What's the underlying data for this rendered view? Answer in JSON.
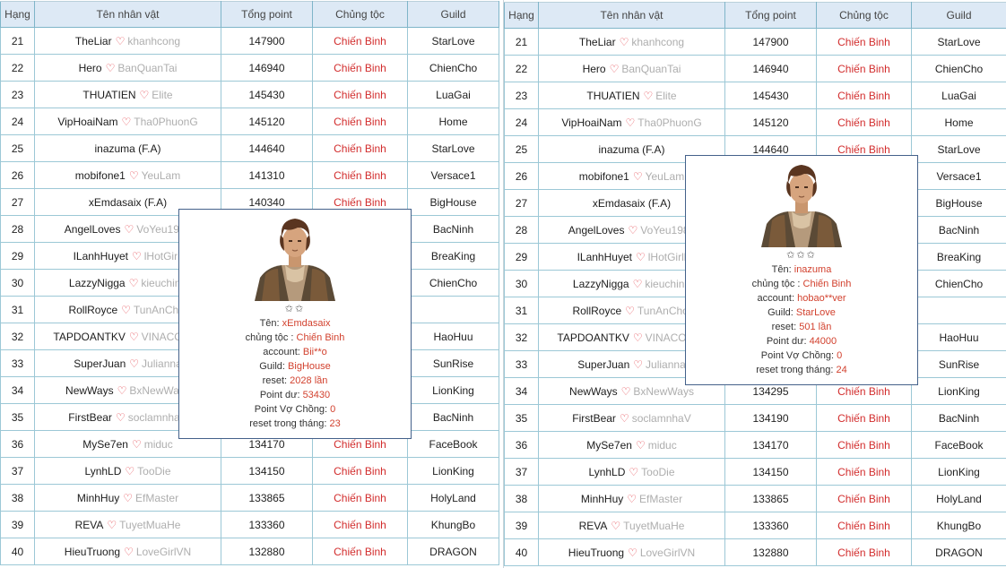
{
  "headers": {
    "rank": "Hạng",
    "name": "Tên nhân vật",
    "points": "Tổng point",
    "class": "Chủng tộc",
    "guild": "Guild"
  },
  "icons": {
    "heart": "heart-icon",
    "star": "star-outline-icon"
  },
  "colors": {
    "class_text": "#d22d2d",
    "spouse_text": "#aeaeae",
    "heart": "#e23a43",
    "header_bg": "#dde9f5"
  },
  "left": {
    "rows": [
      {
        "rank": "21",
        "name": "TheLiar",
        "spouse": "khanhcong",
        "points": "147900",
        "class": "Chiến Binh",
        "guild": "StarLove"
      },
      {
        "rank": "22",
        "name": "Hero",
        "spouse": "BanQuanTai",
        "points": "146940",
        "class": "Chiến Binh",
        "guild": "ChienCho"
      },
      {
        "rank": "23",
        "name": "THUATIEN",
        "spouse": "Elite",
        "points": "145430",
        "class": "Chiến Binh",
        "guild": "LuaGai"
      },
      {
        "rank": "24",
        "name": "VipHoaiNam",
        "spouse": "Tha0PhuonG",
        "points": "145120",
        "class": "Chiến Binh",
        "guild": "Home"
      },
      {
        "rank": "25",
        "name": "inazuma (F.A)",
        "spouse": "",
        "points": "144640",
        "class": "Chiến Binh",
        "guild": "StarLove"
      },
      {
        "rank": "26",
        "name": "mobifone1",
        "spouse": "YeuLam",
        "points": "141310",
        "class": "Chiến Binh",
        "guild": "Versace1"
      },
      {
        "rank": "27",
        "name": "xEmdasaix (F.A)",
        "spouse": "",
        "points": "140340",
        "class": "Chiến Binh",
        "guild": "BigHouse"
      },
      {
        "rank": "28",
        "name": "AngelLoves",
        "spouse": "VoYeu1988",
        "points": "1402",
        "class": "Chiến Binh",
        "guild": "BacNinh"
      },
      {
        "rank": "29",
        "name": "ILanhHuyet",
        "spouse": "lHotGirll",
        "points": "1388",
        "class": "Chiến Binh",
        "guild": "BreaKing"
      },
      {
        "rank": "30",
        "name": "LazzyNigga",
        "spouse": "kieuchinh",
        "points": "",
        "class": "Chiến Binh",
        "guild": "ChienCho"
      },
      {
        "rank": "31",
        "name": "RollRoyce",
        "spouse": "TunAnChoi",
        "points": "1353",
        "class": "Chiến Binh",
        "guild": ""
      },
      {
        "rank": "32",
        "name": "TAPDOANTKV",
        "spouse": "VINACOMIN",
        "points": "",
        "class": "Chiến Binh",
        "guild": "HaoHuu"
      },
      {
        "rank": "33",
        "name": "SuperJuan",
        "spouse": "Julianna",
        "points": "",
        "class": "Chiến Binh",
        "guild": "SunRise"
      },
      {
        "rank": "34",
        "name": "NewWays",
        "spouse": "BxNewWays",
        "points": "",
        "class": "Chiến Binh",
        "guild": "LionKing"
      },
      {
        "rank": "35",
        "name": "FirstBear",
        "spouse": "soclamnhaV",
        "points": "",
        "class": "Chiến Binh",
        "guild": "BacNinh"
      },
      {
        "rank": "36",
        "name": "MySe7en",
        "spouse": "miduc",
        "points": "134170",
        "class": "Chiến Binh",
        "guild": "FaceBook"
      },
      {
        "rank": "37",
        "name": "LynhLD",
        "spouse": "TooDie",
        "points": "134150",
        "class": "Chiến Binh",
        "guild": "LionKing"
      },
      {
        "rank": "38",
        "name": "MinhHuy",
        "spouse": "EfMaster",
        "points": "133865",
        "class": "Chiến Binh",
        "guild": "HolyLand"
      },
      {
        "rank": "39",
        "name": "REVA",
        "spouse": "TuyetMuaHe",
        "points": "133360",
        "class": "Chiến Binh",
        "guild": "KhungBo"
      },
      {
        "rank": "40",
        "name": "HieuTruong",
        "spouse": "LoveGirlVN",
        "points": "132880",
        "class": "Chiến Binh",
        "guild": "DRAGON"
      }
    ],
    "popup": {
      "stars": "✩✩",
      "name_label": "Tên:",
      "name_value": "xEmdasaix",
      "class_label": "chủng tộc :",
      "class_value": "Chiến Binh",
      "account_label": "account:",
      "account_value": "Bii**o",
      "guild_label": "Guild:",
      "guild_value": "BigHouse",
      "reset_label": "reset:",
      "reset_value": "2028 lần",
      "pointdu_label": "Point dư:",
      "pointdu_value": "53430",
      "spousepoint_label": "Point Vợ Chồng:",
      "spousepoint_value": "0",
      "monthreset_label": "reset trong tháng:",
      "monthreset_value": "23"
    }
  },
  "right": {
    "rows": [
      {
        "rank": "21",
        "name": "TheLiar",
        "spouse": "khanhcong",
        "points": "147900",
        "class": "Chiến Binh",
        "guild": "StarLove"
      },
      {
        "rank": "22",
        "name": "Hero",
        "spouse": "BanQuanTai",
        "points": "146940",
        "class": "Chiến Binh",
        "guild": "ChienCho"
      },
      {
        "rank": "23",
        "name": "THUATIEN",
        "spouse": "Elite",
        "points": "145430",
        "class": "Chiến Binh",
        "guild": "LuaGai"
      },
      {
        "rank": "24",
        "name": "VipHoaiNam",
        "spouse": "Tha0PhuonG",
        "points": "145120",
        "class": "Chiến Binh",
        "guild": "Home"
      },
      {
        "rank": "25",
        "name": "inazuma (F.A)",
        "spouse": "",
        "points": "144640",
        "class": "Chiến Binh",
        "guild": "StarLove"
      },
      {
        "rank": "26",
        "name": "mobifone1",
        "spouse": "YeuLam",
        "points": "14131",
        "class": "Chiến Binh",
        "guild": "Versace1"
      },
      {
        "rank": "27",
        "name": "xEmdasaix (F.A)",
        "spouse": "",
        "points": "14034",
        "class": "Chiến Binh",
        "guild": "BigHouse"
      },
      {
        "rank": "28",
        "name": "AngelLoves",
        "spouse": "VoYeu1988",
        "points": "",
        "class": "Chiến Binh",
        "guild": "BacNinh"
      },
      {
        "rank": "29",
        "name": "ILanhHuyet",
        "spouse": "lHotGirll",
        "points": "1388",
        "class": "Chiến Binh",
        "guild": "BreaKing"
      },
      {
        "rank": "30",
        "name": "LazzyNigga",
        "spouse": "kieuchinh",
        "points": "",
        "class": "Chiến Binh",
        "guild": "ChienCho"
      },
      {
        "rank": "31",
        "name": "RollRoyce",
        "spouse": "TunAnChoi",
        "points": "",
        "class": "Chiến Binh",
        "guild": ""
      },
      {
        "rank": "32",
        "name": "TAPDOANTKV",
        "spouse": "VINACOMIN",
        "points": "",
        "class": "Chiến Binh",
        "guild": "HaoHuu"
      },
      {
        "rank": "33",
        "name": "SuperJuan",
        "spouse": "Julianna",
        "points": "",
        "class": "Chiến Binh",
        "guild": "SunRise"
      },
      {
        "rank": "34",
        "name": "NewWays",
        "spouse": "BxNewWays",
        "points": "134295",
        "class": "Chiến Binh",
        "guild": "LionKing"
      },
      {
        "rank": "35",
        "name": "FirstBear",
        "spouse": "soclamnhaV",
        "points": "134190",
        "class": "Chiến Binh",
        "guild": "BacNinh"
      },
      {
        "rank": "36",
        "name": "MySe7en",
        "spouse": "miduc",
        "points": "134170",
        "class": "Chiến Binh",
        "guild": "FaceBook"
      },
      {
        "rank": "37",
        "name": "LynhLD",
        "spouse": "TooDie",
        "points": "134150",
        "class": "Chiến Binh",
        "guild": "LionKing"
      },
      {
        "rank": "38",
        "name": "MinhHuy",
        "spouse": "EfMaster",
        "points": "133865",
        "class": "Chiến Binh",
        "guild": "HolyLand"
      },
      {
        "rank": "39",
        "name": "REVA",
        "spouse": "TuyetMuaHe",
        "points": "133360",
        "class": "Chiến Binh",
        "guild": "KhungBo"
      },
      {
        "rank": "40",
        "name": "HieuTruong",
        "spouse": "LoveGirlVN",
        "points": "132880",
        "class": "Chiến Binh",
        "guild": "DRAGON"
      }
    ],
    "popup": {
      "stars": "✩✩✩",
      "name_label": "Tên:",
      "name_value": "inazuma",
      "class_label": "chủng tộc :",
      "class_value": "Chiến Binh",
      "account_label": "account:",
      "account_value": "hobao**ver",
      "guild_label": "Guild:",
      "guild_value": "StarLove",
      "reset_label": "reset:",
      "reset_value": "501 lần",
      "pointdu_label": "Point dư:",
      "pointdu_value": "44000",
      "spousepoint_label": "Point Vợ Chồng:",
      "spousepoint_value": "0",
      "monthreset_label": "reset trong tháng:",
      "monthreset_value": "24"
    }
  }
}
